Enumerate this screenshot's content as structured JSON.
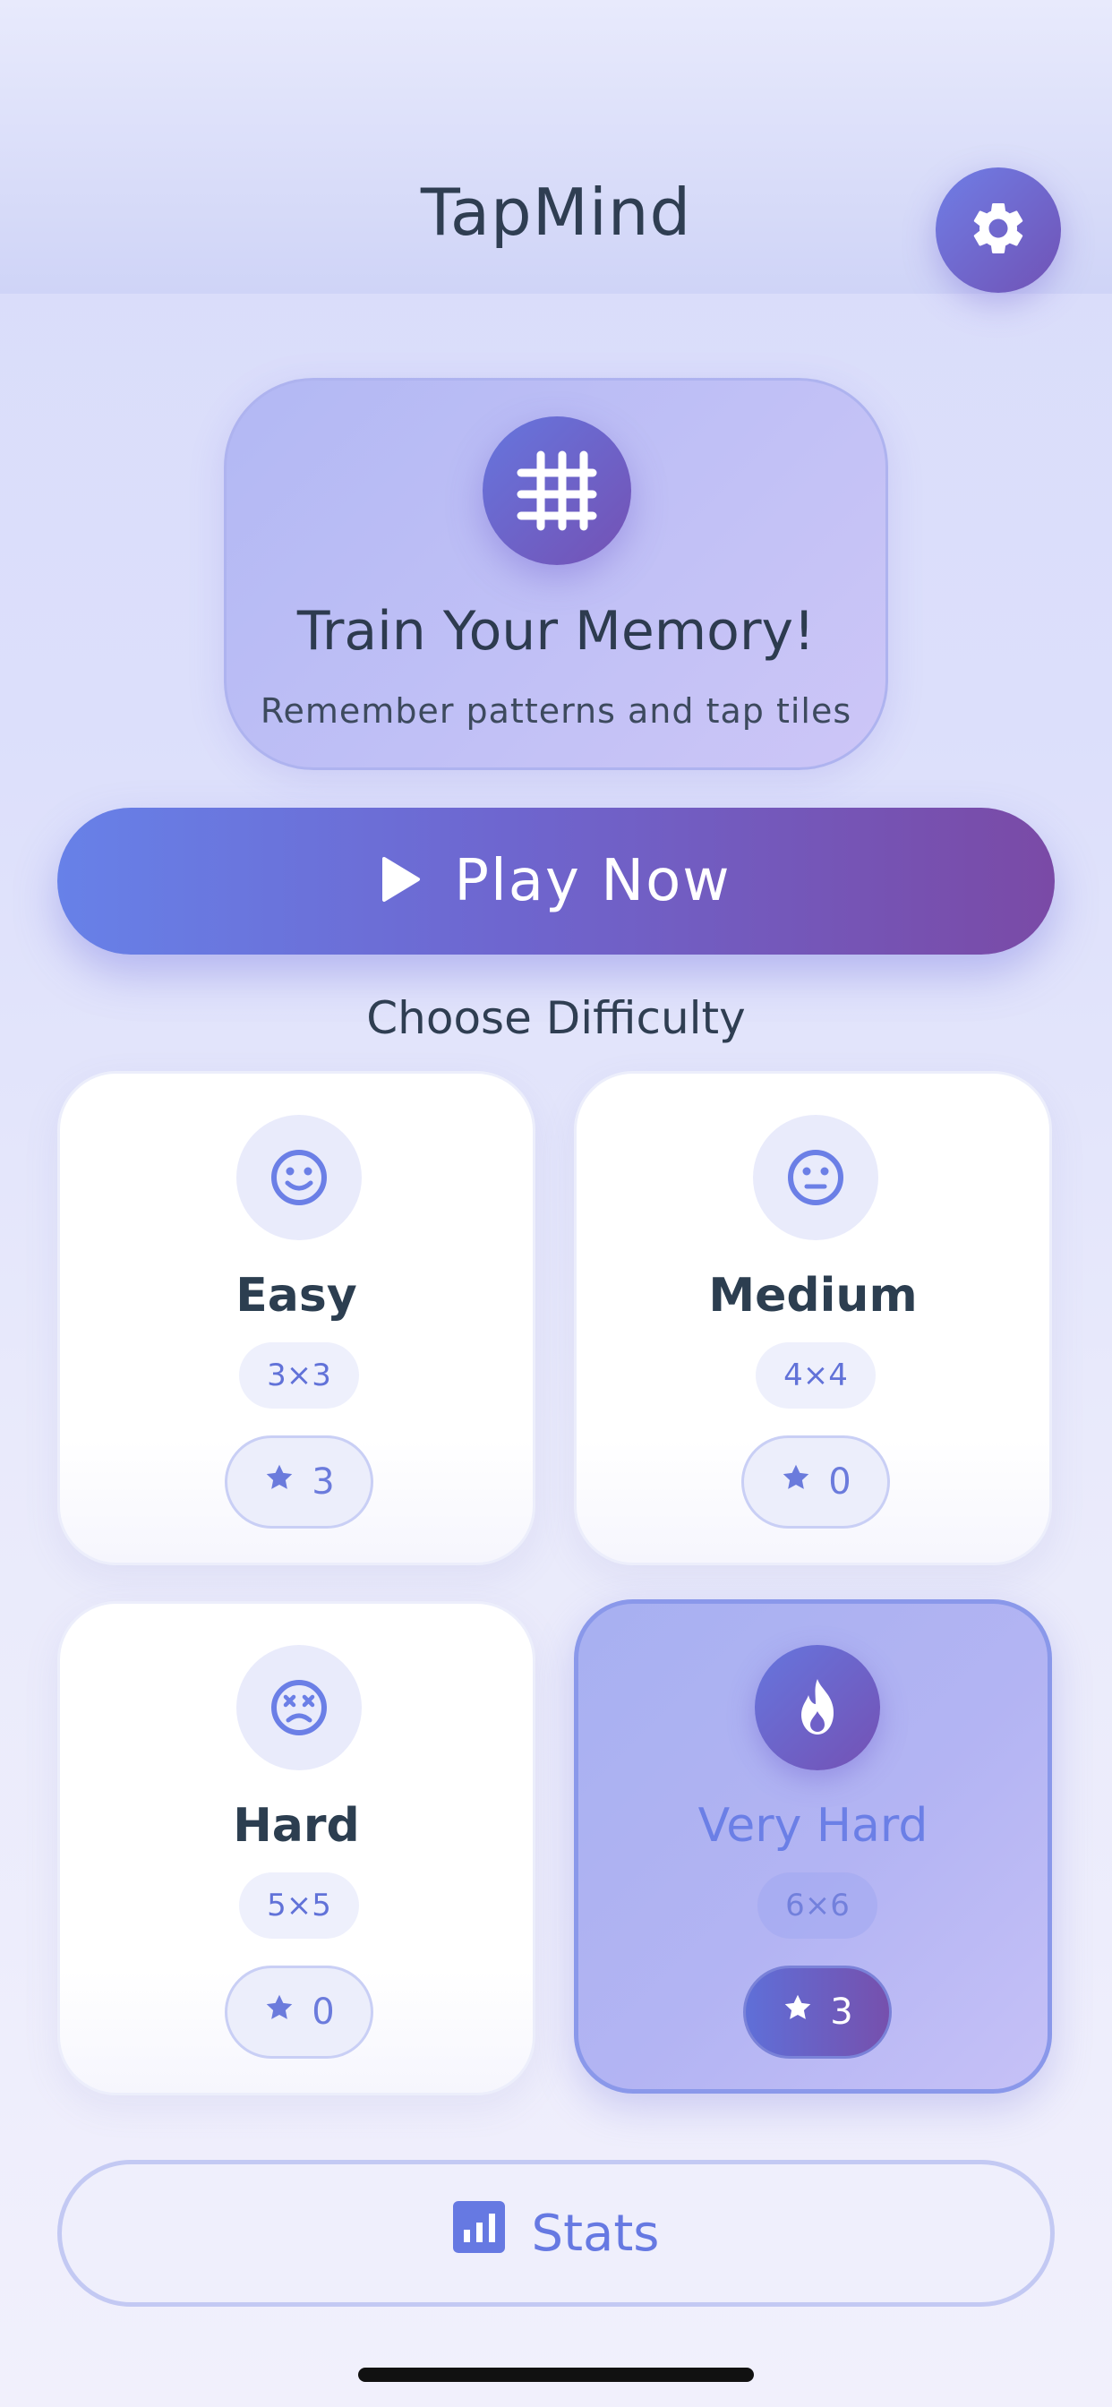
{
  "app": {
    "title": "TapMind"
  },
  "header": {
    "settings_icon": "gear-icon"
  },
  "hero": {
    "icon": "grid-icon",
    "title": "Train Your Memory!",
    "subtitle": "Remember patterns and tap tiles"
  },
  "play": {
    "label": "Play Now",
    "icon": "play-icon"
  },
  "difficulty": {
    "heading": "Choose Difficulty",
    "levels": [
      {
        "name": "Easy",
        "grid": "3×3",
        "stars": "3",
        "icon": "smile-icon",
        "selected": false
      },
      {
        "name": "Medium",
        "grid": "4×4",
        "stars": "0",
        "icon": "neutral-face-icon",
        "selected": false
      },
      {
        "name": "Hard",
        "grid": "5×5",
        "stars": "0",
        "icon": "dizzy-face-icon",
        "selected": false
      },
      {
        "name": "Very Hard",
        "grid": "6×6",
        "stars": "3",
        "icon": "fire-icon",
        "selected": true
      }
    ]
  },
  "stats": {
    "label": "Stats",
    "icon": "chart-icon"
  },
  "colors": {
    "accent": "#6b7fe6",
    "accent_dark": "#7451b4",
    "text": "#2c3e50"
  }
}
